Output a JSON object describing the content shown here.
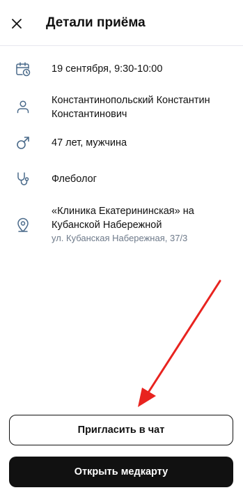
{
  "header": {
    "title": "Детали приёма",
    "close_icon": "close-icon"
  },
  "details": {
    "datetime": {
      "icon": "calendar-clock-icon",
      "text": "19 сентября, 9:30-10:00"
    },
    "doctor": {
      "icon": "person-icon",
      "text": "Константинопольский Константин Константинович"
    },
    "patient": {
      "icon": "male-icon",
      "text": "47 лет, мужчина"
    },
    "specialty": {
      "icon": "stethoscope-icon",
      "text": "Флеболог"
    },
    "clinic": {
      "icon": "location-pin-icon",
      "name": "«Клиника Екатерининская» на Кубанской Набережной",
      "address": "ул. Кубанская Набережная, 37/3"
    }
  },
  "actions": {
    "invite_label": "Пригласить в чат",
    "open_record_label": "Открыть медкарту"
  },
  "colors": {
    "icon": "#4a6a8a",
    "annotation_arrow": "#e8231f",
    "primary_button": "#111111"
  }
}
